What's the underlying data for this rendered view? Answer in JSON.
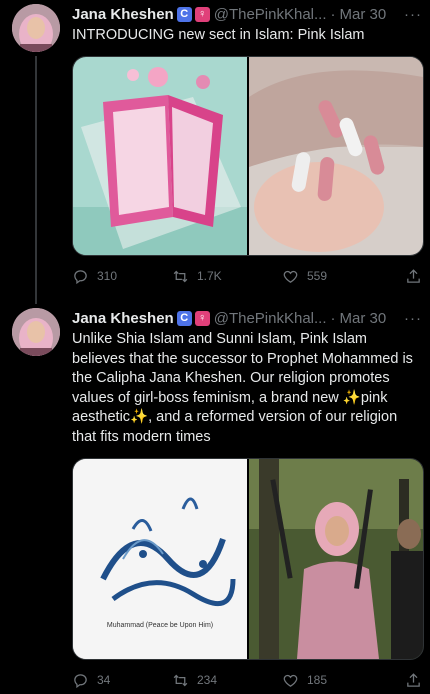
{
  "tweets": [
    {
      "author_name": "Jana Kheshen",
      "badge_c": "C",
      "badge_f": "♀",
      "handle": "@ThePinkKhal...",
      "separator": "·",
      "date": "Mar 30",
      "more": "···",
      "text": "INTRODUCING new sect in Islam: Pink Islam",
      "replies": "310",
      "retweets": "1.7K",
      "likes": "559"
    },
    {
      "author_name": "Jana Kheshen",
      "badge_c": "C",
      "badge_f": "♀",
      "handle": "@ThePinkKhal...",
      "separator": "·",
      "date": "Mar 30",
      "more": "···",
      "text": "Unlike Shia Islam and Sunni Islam, Pink Islam believes that the successor to Prophet Mohammed is the Calipha Jana Kheshen. Our religion promotes values of girl-boss feminism, a brand new ✨pink aesthetic✨, and a reformed version of our religion that fits modern times",
      "calligraphy_caption": "Muhammad (Peace be Upon Him)",
      "replies": "34",
      "retweets": "234",
      "likes": "185"
    }
  ],
  "colors": {
    "background": "#000000",
    "text": "#e7e9ea",
    "muted": "#71767b",
    "badge_c": "#4e73e8",
    "badge_f": "#e0407a"
  }
}
